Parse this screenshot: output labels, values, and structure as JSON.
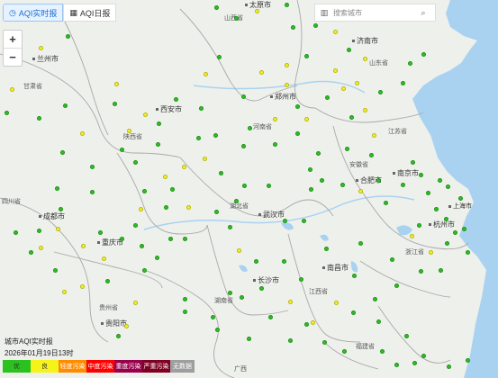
{
  "tabs": [
    {
      "label": "AQI实时报",
      "icon": "clock-icon",
      "active": true
    },
    {
      "label": "AQI日报",
      "icon": "calendar-icon",
      "active": false
    }
  ],
  "zoom": {
    "in": "+",
    "out": "−"
  },
  "search": {
    "placeholder": "搜索城市",
    "building_icon": "building-icon",
    "search_icon": "search-icon"
  },
  "cities": [
    "太原市",
    "济南市",
    "兰州市",
    "郑州市",
    "西安市",
    "合肥市",
    "南京市",
    "成都市",
    "武汉市",
    "上海市",
    "杭州市",
    "重庆市",
    "长沙市",
    "南昌市",
    "贵阳市"
  ],
  "provinces": [
    "山西省",
    "山东省",
    "甘肃省",
    "河南省",
    "陕西省",
    "江苏省",
    "安徽省",
    "湖北省",
    "四川省",
    "浙江省",
    "湖南省",
    "江西省",
    "贵州省",
    "福建省",
    "广西"
  ],
  "legend": {
    "title": "城市AQI实时报",
    "time": "2026年01月19日13时",
    "levels": [
      {
        "label": "优",
        "color": "#2bc21f"
      },
      {
        "label": "良",
        "color": "#f6f31b"
      },
      {
        "label": "轻度污染",
        "color": "#ff8c00"
      },
      {
        "label": "中度污染",
        "color": "#ff0000"
      },
      {
        "label": "重度污染",
        "color": "#99004c"
      },
      {
        "label": "严重污染",
        "color": "#7e0023"
      },
      {
        "label": "无数据",
        "color": "#9e9e9e"
      }
    ]
  },
  "colors": {
    "good": "#2bc21f",
    "moderate": "#f6f31b",
    "water": "#a8d1f0",
    "border": "#b0b0b0"
  }
}
